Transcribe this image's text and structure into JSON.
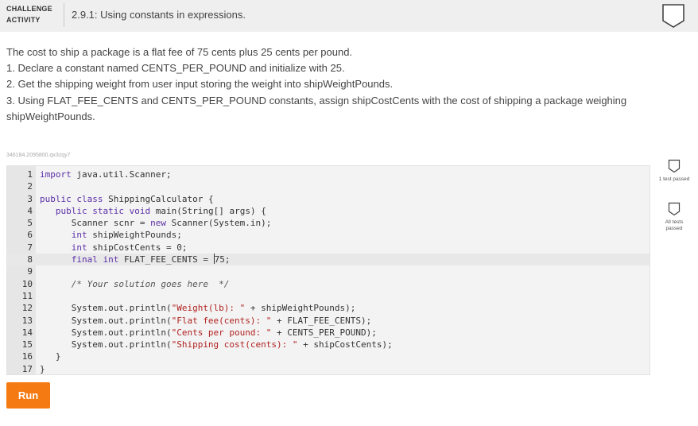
{
  "header": {
    "badge_line1": "CHALLENGE",
    "badge_line2": "ACTIVITY",
    "title": "2.9.1: Using constants in expressions."
  },
  "prompt": {
    "lines": [
      "The cost to ship a package is a flat fee of 75 cents plus 25 cents per pound.",
      "1. Declare a constant named CENTS_PER_POUND and initialize with 25.",
      "2. Get the shipping weight from user input storing the weight into shipWeightPounds.",
      "3. Using FLAT_FEE_CENTS and CENTS_PER_POUND constants, assign shipCostCents with the cost of shipping a package weighing shipWeightPounds."
    ]
  },
  "activity_id": "346184.2095800.qx3zqy7",
  "editor": {
    "lines": [
      "import java.util.Scanner;",
      "",
      "public class ShippingCalculator {",
      "   public static void main(String[] args) {",
      "      Scanner scnr = new Scanner(System.in);",
      "      int shipWeightPounds;",
      "      int shipCostCents = 0;",
      "      final int FLAT_FEE_CENTS = 75;",
      "",
      "      /* Your solution goes here  */",
      "",
      "      System.out.println(\"Weight(lb): \" + shipWeightPounds);",
      "      System.out.println(\"Flat fee(cents): \" + FLAT_FEE_CENTS);",
      "      System.out.println(\"Cents per pound: \" + CENTS_PER_POUND);",
      "      System.out.println(\"Shipping cost(cents): \" + shipCostCents);",
      "   }",
      "}"
    ],
    "line_numbers": [
      "1",
      "2",
      "3",
      "4",
      "5",
      "6",
      "7",
      "8",
      "9",
      "10",
      "11",
      "12",
      "13",
      "14",
      "15",
      "16",
      "17"
    ]
  },
  "results": {
    "test1": "1 test passed",
    "test2": "All tests passed"
  },
  "run_label": "Run",
  "colors": {
    "accent": "#f47a11",
    "keyword": "#5b2fa8",
    "string": "#b22222"
  },
  "icons": {
    "completion": "shield-outline-icon",
    "test_result": "shield-outline-icon"
  }
}
